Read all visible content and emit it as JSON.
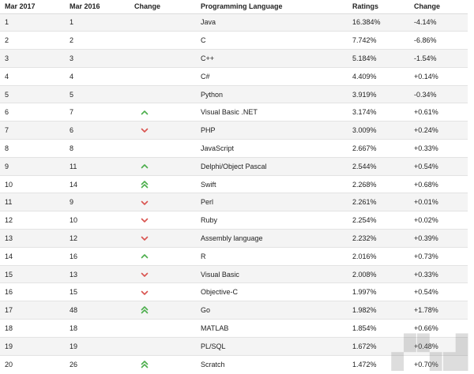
{
  "table": {
    "headers": [
      "Mar 2017",
      "Mar 2016",
      "Change",
      "Programming Language",
      "Ratings",
      "Change"
    ],
    "rows": [
      {
        "mar2017": "1",
        "mar2016": "1",
        "trend": "none",
        "language": "Java",
        "rating": "16.384%",
        "change": "-4.14%"
      },
      {
        "mar2017": "2",
        "mar2016": "2",
        "trend": "none",
        "language": "C",
        "rating": "7.742%",
        "change": "-6.86%"
      },
      {
        "mar2017": "3",
        "mar2016": "3",
        "trend": "none",
        "language": "C++",
        "rating": "5.184%",
        "change": "-1.54%"
      },
      {
        "mar2017": "4",
        "mar2016": "4",
        "trend": "none",
        "language": "C#",
        "rating": "4.409%",
        "change": "+0.14%"
      },
      {
        "mar2017": "5",
        "mar2016": "5",
        "trend": "none",
        "language": "Python",
        "rating": "3.919%",
        "change": "-0.34%"
      },
      {
        "mar2017": "6",
        "mar2016": "7",
        "trend": "up",
        "language": "Visual Basic .NET",
        "rating": "3.174%",
        "change": "+0.61%"
      },
      {
        "mar2017": "7",
        "mar2016": "6",
        "trend": "down",
        "language": "PHP",
        "rating": "3.009%",
        "change": "+0.24%"
      },
      {
        "mar2017": "8",
        "mar2016": "8",
        "trend": "none",
        "language": "JavaScript",
        "rating": "2.667%",
        "change": "+0.33%"
      },
      {
        "mar2017": "9",
        "mar2016": "11",
        "trend": "up",
        "language": "Delphi/Object Pascal",
        "rating": "2.544%",
        "change": "+0.54%"
      },
      {
        "mar2017": "10",
        "mar2016": "14",
        "trend": "double-up",
        "language": "Swift",
        "rating": "2.268%",
        "change": "+0.68%"
      },
      {
        "mar2017": "11",
        "mar2016": "9",
        "trend": "down",
        "language": "Perl",
        "rating": "2.261%",
        "change": "+0.01%"
      },
      {
        "mar2017": "12",
        "mar2016": "10",
        "trend": "down",
        "language": "Ruby",
        "rating": "2.254%",
        "change": "+0.02%"
      },
      {
        "mar2017": "13",
        "mar2016": "12",
        "trend": "down",
        "language": "Assembly language",
        "rating": "2.232%",
        "change": "+0.39%"
      },
      {
        "mar2017": "14",
        "mar2016": "16",
        "trend": "up",
        "language": "R",
        "rating": "2.016%",
        "change": "+0.73%"
      },
      {
        "mar2017": "15",
        "mar2016": "13",
        "trend": "down",
        "language": "Visual Basic",
        "rating": "2.008%",
        "change": "+0.33%"
      },
      {
        "mar2017": "16",
        "mar2016": "15",
        "trend": "down",
        "language": "Objective-C",
        "rating": "1.997%",
        "change": "+0.54%"
      },
      {
        "mar2017": "17",
        "mar2016": "48",
        "trend": "double-up",
        "language": "Go",
        "rating": "1.982%",
        "change": "+1.78%"
      },
      {
        "mar2017": "18",
        "mar2016": "18",
        "trend": "none",
        "language": "MATLAB",
        "rating": "1.854%",
        "change": "+0.66%"
      },
      {
        "mar2017": "19",
        "mar2016": "19",
        "trend": "none",
        "language": "PL/SQL",
        "rating": "1.672%",
        "change": "+0.48%"
      },
      {
        "mar2017": "20",
        "mar2016": "26",
        "trend": "double-up",
        "language": "Scratch",
        "rating": "1.472%",
        "change": "+0.70%"
      }
    ]
  },
  "colors": {
    "up": "#4cae4c",
    "down": "#d9534f"
  }
}
